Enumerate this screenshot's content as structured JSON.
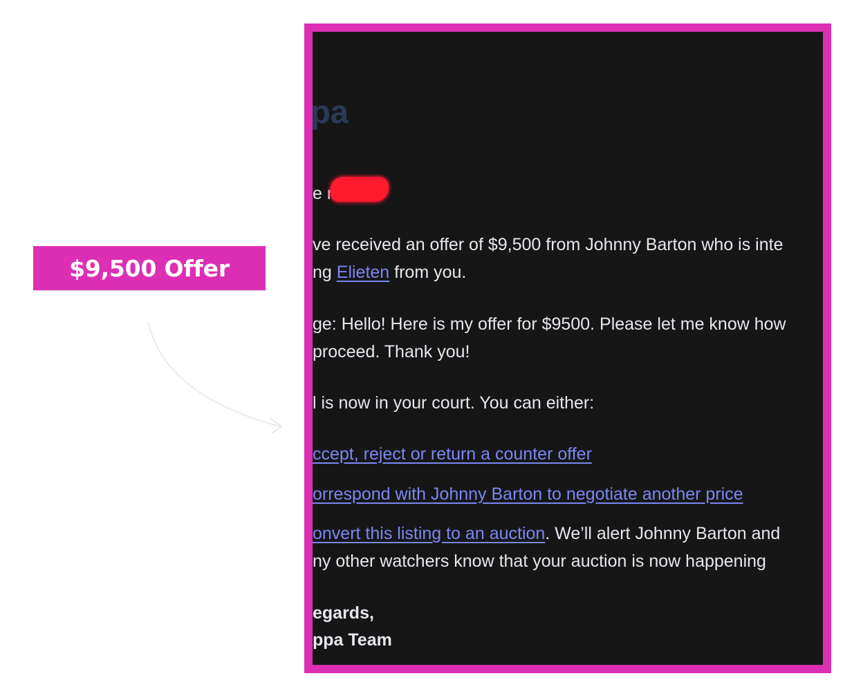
{
  "badge": {
    "label": "$9,500 Offer"
  },
  "email": {
    "logo_fragment": "pa",
    "greeting_fragment": "e r",
    "offer_line1": "ve received an offer of $9,500 from Johnny Barton who is inte",
    "offer_line2_prefix": "ng ",
    "offer_line2_link": "Elieten",
    "offer_line2_suffix": " from you.",
    "message_line1": "ge: Hello! Here is my offer for $9500. Please let me know how",
    "message_line2": " proceed. Thank you!",
    "court_line": "l is now in your court. You can either:",
    "option_accept_link": "ccept, reject or return a counter offer",
    "option_correspond_link": "orrespond with Johnny Barton to negotiate another price",
    "option_convert_link": "onvert this listing to an auction",
    "option_convert_suffix": ". We’ll alert Johnny Barton and",
    "option_convert_line2": "ny other watchers know that your auction is now happening",
    "signoff_line1": "egards,",
    "signoff_line2": "ppa Team"
  },
  "colors": {
    "accent": "#dc2fb3",
    "email_background": "#161617",
    "link": "#7c86f2",
    "redaction": "#ff1a2d"
  }
}
